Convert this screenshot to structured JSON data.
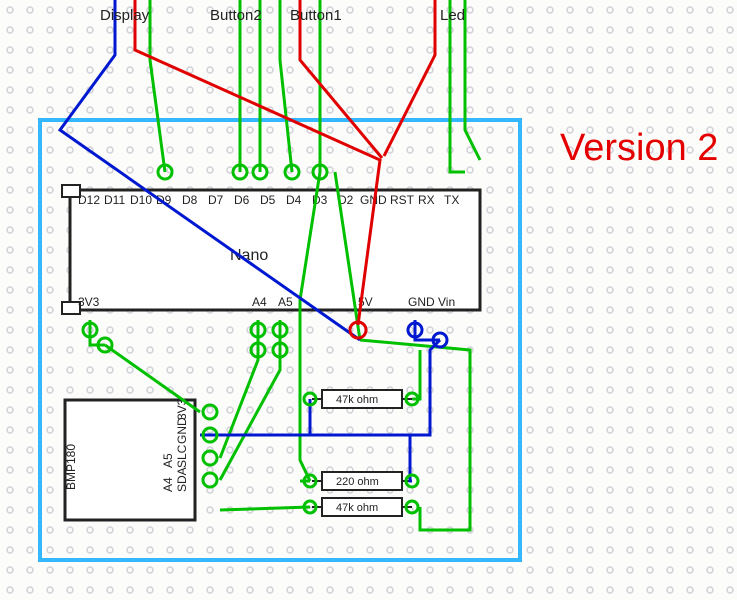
{
  "title": "Version 2",
  "labels": {
    "display": "Display",
    "button2": "Button2",
    "button1": "Button1",
    "led": "Led"
  },
  "microcontroller": {
    "name": "Nano",
    "pins_top": [
      "D12",
      "D11",
      "D10",
      "D9",
      "D8",
      "D7",
      "D6",
      "D5",
      "D4",
      "D3",
      "D2",
      "GND",
      "RST",
      "RX",
      "TX"
    ],
    "pins_bottom": [
      "3V3",
      "",
      "",
      "",
      "",
      "",
      "",
      "A4",
      "A5",
      "",
      "",
      "5V",
      "",
      "GND",
      "Vin"
    ]
  },
  "sensor": {
    "name": "BMP180",
    "pins": [
      "3V3",
      "GND",
      "SLC",
      "SDA"
    ],
    "map": [
      "",
      "",
      "A5",
      "A4"
    ]
  },
  "resistors": [
    {
      "value": "47k ohm"
    },
    {
      "value": "220 ohm"
    },
    {
      "value": "47k ohm"
    }
  ]
}
